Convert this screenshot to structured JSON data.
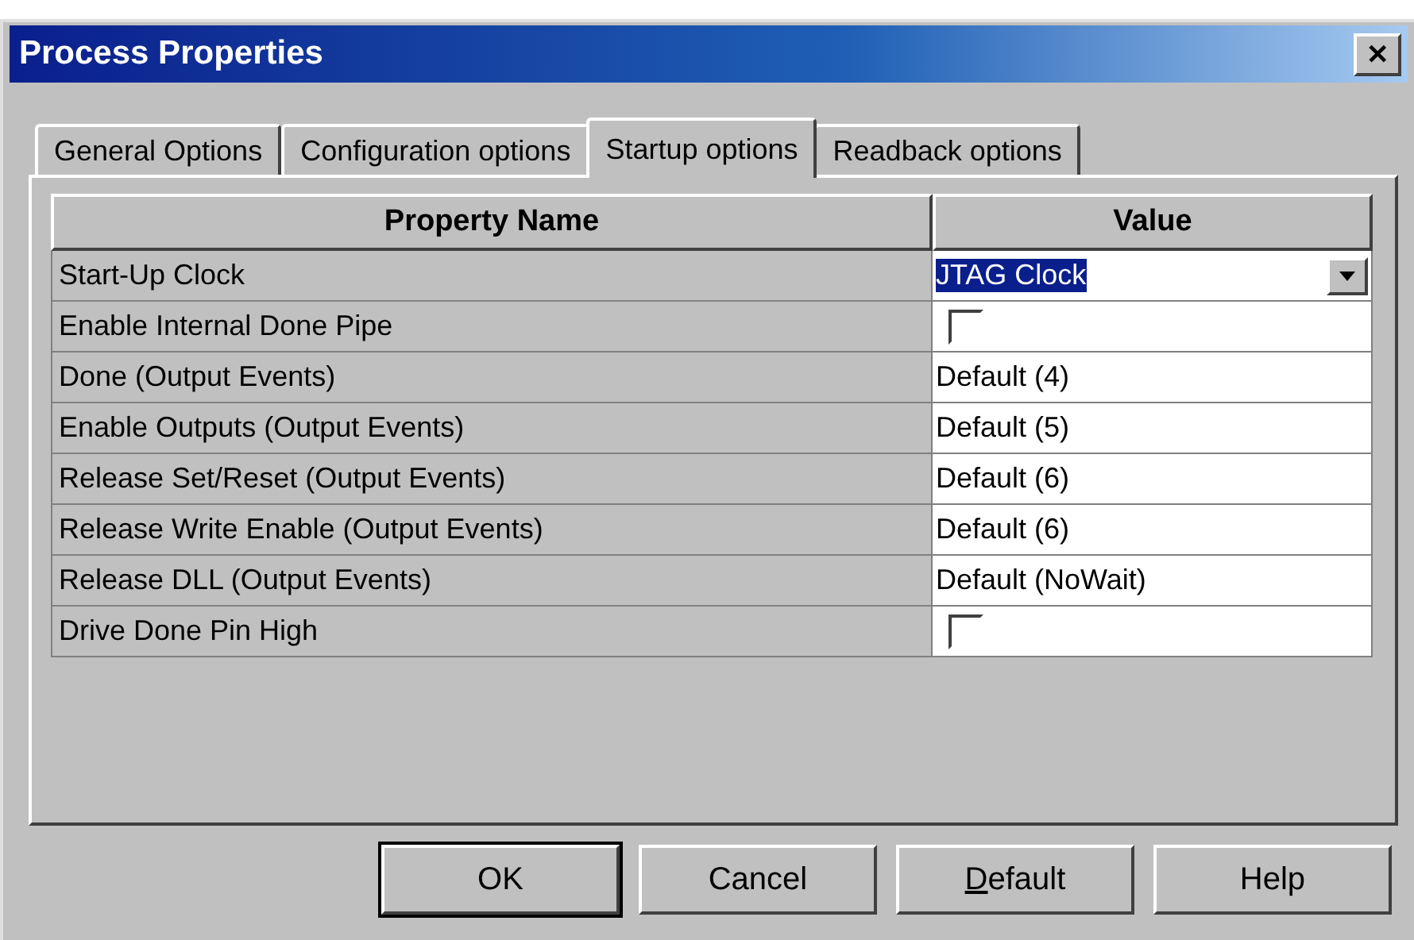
{
  "window": {
    "title": "Process Properties",
    "close": "✕"
  },
  "tabs": [
    {
      "label": "General Options",
      "selected": false
    },
    {
      "label": "Configuration options",
      "selected": false
    },
    {
      "label": "Startup options",
      "selected": true
    },
    {
      "label": "Readback options",
      "selected": false
    }
  ],
  "table": {
    "columns": [
      "Property Name",
      "Value"
    ],
    "rows": [
      {
        "name": "Start-Up Clock",
        "kind": "dropdown",
        "value": "JTAG Clock",
        "selected": true
      },
      {
        "name": "Enable Internal Done Pipe",
        "kind": "checkbox",
        "checked": false
      },
      {
        "name": "Done (Output Events)",
        "kind": "text",
        "value": "Default (4)"
      },
      {
        "name": "Enable Outputs (Output Events)",
        "kind": "text",
        "value": "Default (5)"
      },
      {
        "name": "Release Set/Reset (Output Events)",
        "kind": "text",
        "value": "Default (6)"
      },
      {
        "name": "Release Write Enable (Output Events)",
        "kind": "text",
        "value": "Default (6)"
      },
      {
        "name": "Release DLL (Output Events)",
        "kind": "text",
        "value": "Default (NoWait)"
      },
      {
        "name": "Drive Done Pin High",
        "kind": "checkbox",
        "checked": false
      }
    ]
  },
  "buttons": [
    {
      "label": "OK",
      "default": true,
      "underline_first": false
    },
    {
      "label": "Cancel",
      "default": false,
      "underline_first": false
    },
    {
      "label": "Default",
      "default": false,
      "underline_first": true
    },
    {
      "label": "Help",
      "default": false,
      "underline_first": false
    }
  ]
}
